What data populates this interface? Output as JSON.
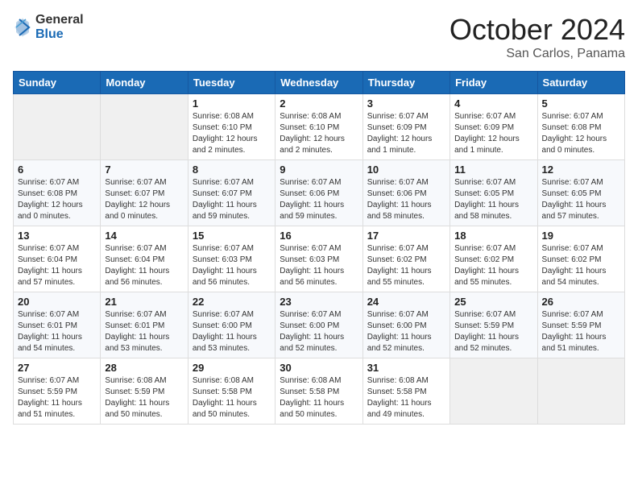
{
  "header": {
    "logo_general": "General",
    "logo_blue": "Blue",
    "month_title": "October 2024",
    "location": "San Carlos, Panama"
  },
  "weekdays": [
    "Sunday",
    "Monday",
    "Tuesday",
    "Wednesday",
    "Thursday",
    "Friday",
    "Saturday"
  ],
  "weeks": [
    [
      {
        "day": "",
        "info": ""
      },
      {
        "day": "",
        "info": ""
      },
      {
        "day": "1",
        "info": "Sunrise: 6:08 AM\nSunset: 6:10 PM\nDaylight: 12 hours\nand 2 minutes."
      },
      {
        "day": "2",
        "info": "Sunrise: 6:08 AM\nSunset: 6:10 PM\nDaylight: 12 hours\nand 2 minutes."
      },
      {
        "day": "3",
        "info": "Sunrise: 6:07 AM\nSunset: 6:09 PM\nDaylight: 12 hours\nand 1 minute."
      },
      {
        "day": "4",
        "info": "Sunrise: 6:07 AM\nSunset: 6:09 PM\nDaylight: 12 hours\nand 1 minute."
      },
      {
        "day": "5",
        "info": "Sunrise: 6:07 AM\nSunset: 6:08 PM\nDaylight: 12 hours\nand 0 minutes."
      }
    ],
    [
      {
        "day": "6",
        "info": "Sunrise: 6:07 AM\nSunset: 6:08 PM\nDaylight: 12 hours\nand 0 minutes."
      },
      {
        "day": "7",
        "info": "Sunrise: 6:07 AM\nSunset: 6:07 PM\nDaylight: 12 hours\nand 0 minutes."
      },
      {
        "day": "8",
        "info": "Sunrise: 6:07 AM\nSunset: 6:07 PM\nDaylight: 11 hours\nand 59 minutes."
      },
      {
        "day": "9",
        "info": "Sunrise: 6:07 AM\nSunset: 6:06 PM\nDaylight: 11 hours\nand 59 minutes."
      },
      {
        "day": "10",
        "info": "Sunrise: 6:07 AM\nSunset: 6:06 PM\nDaylight: 11 hours\nand 58 minutes."
      },
      {
        "day": "11",
        "info": "Sunrise: 6:07 AM\nSunset: 6:05 PM\nDaylight: 11 hours\nand 58 minutes."
      },
      {
        "day": "12",
        "info": "Sunrise: 6:07 AM\nSunset: 6:05 PM\nDaylight: 11 hours\nand 57 minutes."
      }
    ],
    [
      {
        "day": "13",
        "info": "Sunrise: 6:07 AM\nSunset: 6:04 PM\nDaylight: 11 hours\nand 57 minutes."
      },
      {
        "day": "14",
        "info": "Sunrise: 6:07 AM\nSunset: 6:04 PM\nDaylight: 11 hours\nand 56 minutes."
      },
      {
        "day": "15",
        "info": "Sunrise: 6:07 AM\nSunset: 6:03 PM\nDaylight: 11 hours\nand 56 minutes."
      },
      {
        "day": "16",
        "info": "Sunrise: 6:07 AM\nSunset: 6:03 PM\nDaylight: 11 hours\nand 56 minutes."
      },
      {
        "day": "17",
        "info": "Sunrise: 6:07 AM\nSunset: 6:02 PM\nDaylight: 11 hours\nand 55 minutes."
      },
      {
        "day": "18",
        "info": "Sunrise: 6:07 AM\nSunset: 6:02 PM\nDaylight: 11 hours\nand 55 minutes."
      },
      {
        "day": "19",
        "info": "Sunrise: 6:07 AM\nSunset: 6:02 PM\nDaylight: 11 hours\nand 54 minutes."
      }
    ],
    [
      {
        "day": "20",
        "info": "Sunrise: 6:07 AM\nSunset: 6:01 PM\nDaylight: 11 hours\nand 54 minutes."
      },
      {
        "day": "21",
        "info": "Sunrise: 6:07 AM\nSunset: 6:01 PM\nDaylight: 11 hours\nand 53 minutes."
      },
      {
        "day": "22",
        "info": "Sunrise: 6:07 AM\nSunset: 6:00 PM\nDaylight: 11 hours\nand 53 minutes."
      },
      {
        "day": "23",
        "info": "Sunrise: 6:07 AM\nSunset: 6:00 PM\nDaylight: 11 hours\nand 52 minutes."
      },
      {
        "day": "24",
        "info": "Sunrise: 6:07 AM\nSunset: 6:00 PM\nDaylight: 11 hours\nand 52 minutes."
      },
      {
        "day": "25",
        "info": "Sunrise: 6:07 AM\nSunset: 5:59 PM\nDaylight: 11 hours\nand 52 minutes."
      },
      {
        "day": "26",
        "info": "Sunrise: 6:07 AM\nSunset: 5:59 PM\nDaylight: 11 hours\nand 51 minutes."
      }
    ],
    [
      {
        "day": "27",
        "info": "Sunrise: 6:07 AM\nSunset: 5:59 PM\nDaylight: 11 hours\nand 51 minutes."
      },
      {
        "day": "28",
        "info": "Sunrise: 6:08 AM\nSunset: 5:59 PM\nDaylight: 11 hours\nand 50 minutes."
      },
      {
        "day": "29",
        "info": "Sunrise: 6:08 AM\nSunset: 5:58 PM\nDaylight: 11 hours\nand 50 minutes."
      },
      {
        "day": "30",
        "info": "Sunrise: 6:08 AM\nSunset: 5:58 PM\nDaylight: 11 hours\nand 50 minutes."
      },
      {
        "day": "31",
        "info": "Sunrise: 6:08 AM\nSunset: 5:58 PM\nDaylight: 11 hours\nand 49 minutes."
      },
      {
        "day": "",
        "info": ""
      },
      {
        "day": "",
        "info": ""
      }
    ]
  ]
}
